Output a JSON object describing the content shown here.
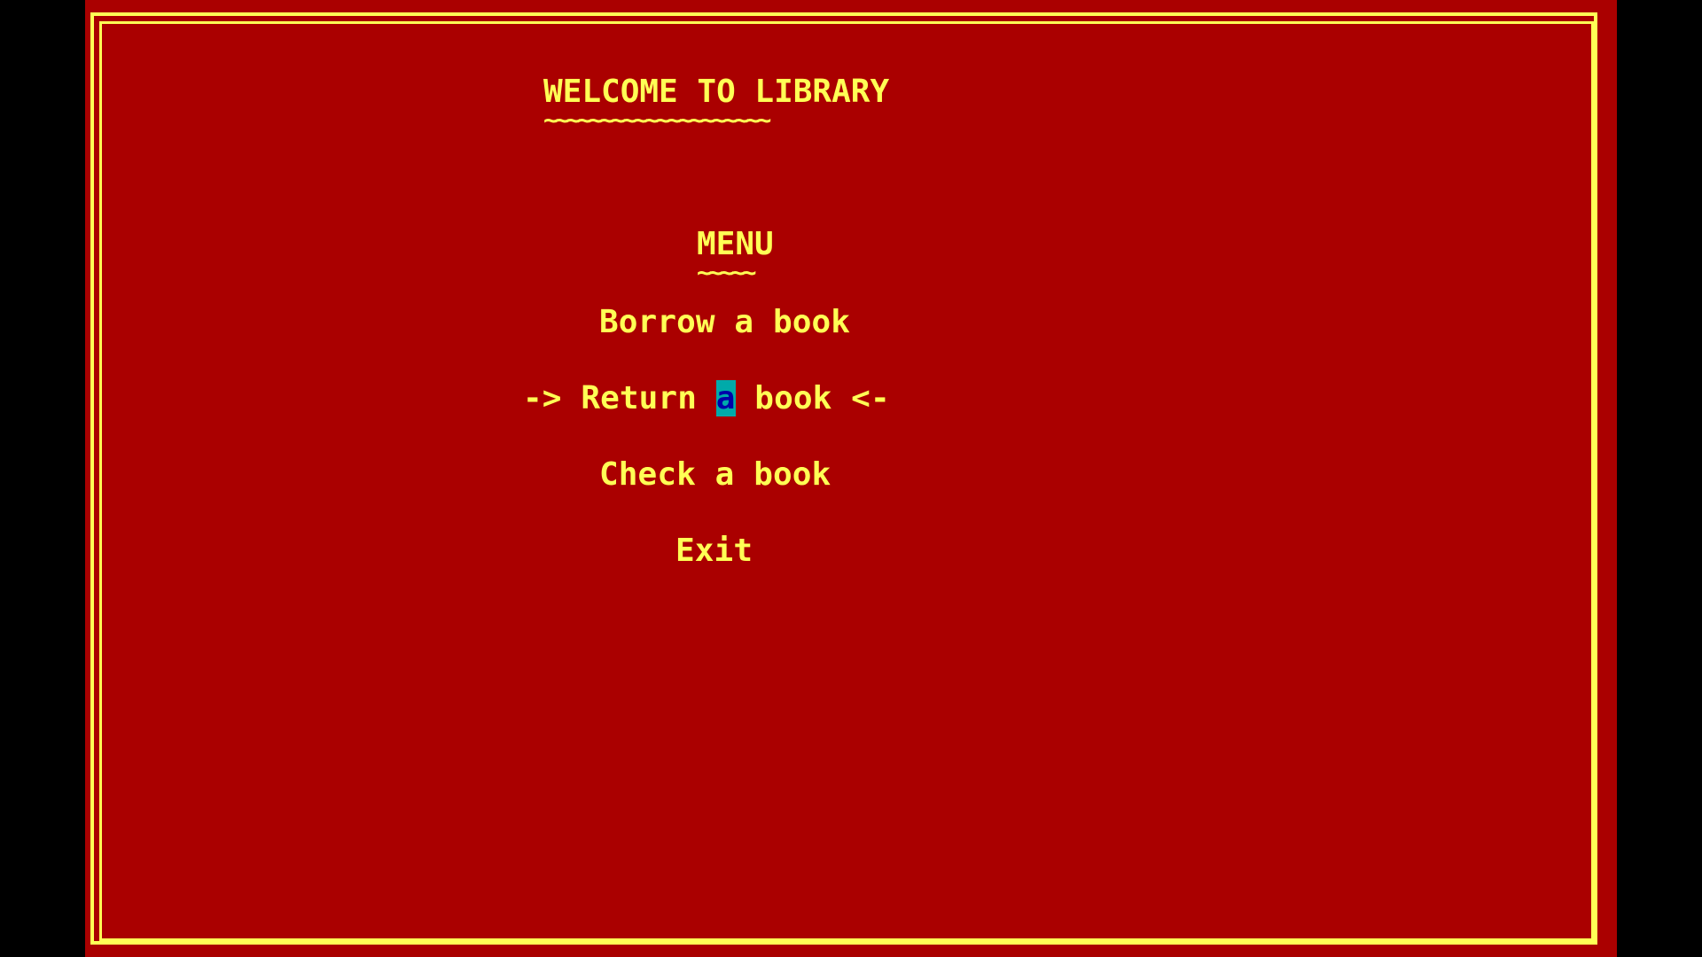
{
  "title": "WELCOME TO LIBRARY",
  "title_underline": "~~~~~~~~~~~~~~~~~~~~",
  "menu": {
    "heading": "MENU",
    "heading_underline": "~~~~~",
    "items": [
      {
        "label": "Borrow a book"
      },
      {
        "prefix": "-> Return ",
        "cursor_char": "a",
        "suffix": " book <-"
      },
      {
        "label": "Check a book"
      },
      {
        "label": "Exit"
      }
    ]
  },
  "colors": {
    "background": "#AA0000",
    "text": "#FFFF55",
    "border": "#FFFF55",
    "cursor_bg": "#00AAAA",
    "cursor_fg": "#0000AA",
    "letterbox": "#000000"
  }
}
